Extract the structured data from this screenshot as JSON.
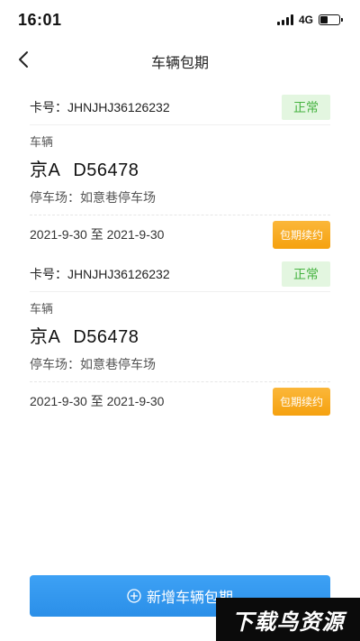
{
  "status_bar": {
    "time": "16:01",
    "network": "4G",
    "battery_level": 0.38
  },
  "nav": {
    "title": "车辆包期"
  },
  "cards": [
    {
      "card_no": "卡号：JHNJHJ36126232",
      "status": "正常",
      "vehicle_label": "车辆",
      "plate_prefix": "京A",
      "plate_number": "D56478",
      "parking": "停车场：如意巷停车场",
      "dates": "2021-9-30 至 2021-9-30",
      "renew_label": "包期续约"
    },
    {
      "card_no": "卡号：JHNJHJ36126232",
      "status": "正常",
      "vehicle_label": "车辆",
      "plate_prefix": "京A",
      "plate_number": "D56478",
      "parking": "停车场：如意巷停车场",
      "dates": "2021-9-30 至 2021-9-30",
      "renew_label": "包期续约"
    }
  ],
  "add_button": {
    "label": "新增车辆包期"
  },
  "watermark": "下载鸟资源",
  "colors": {
    "status_ok_bg": "#e3f6e0",
    "status_ok_text": "#46b341",
    "renew_orange": "#f5a10f",
    "primary_blue": "#2b8fe8"
  },
  "icons": {
    "back": "chevron-left-icon",
    "add": "plus-circle-icon"
  }
}
